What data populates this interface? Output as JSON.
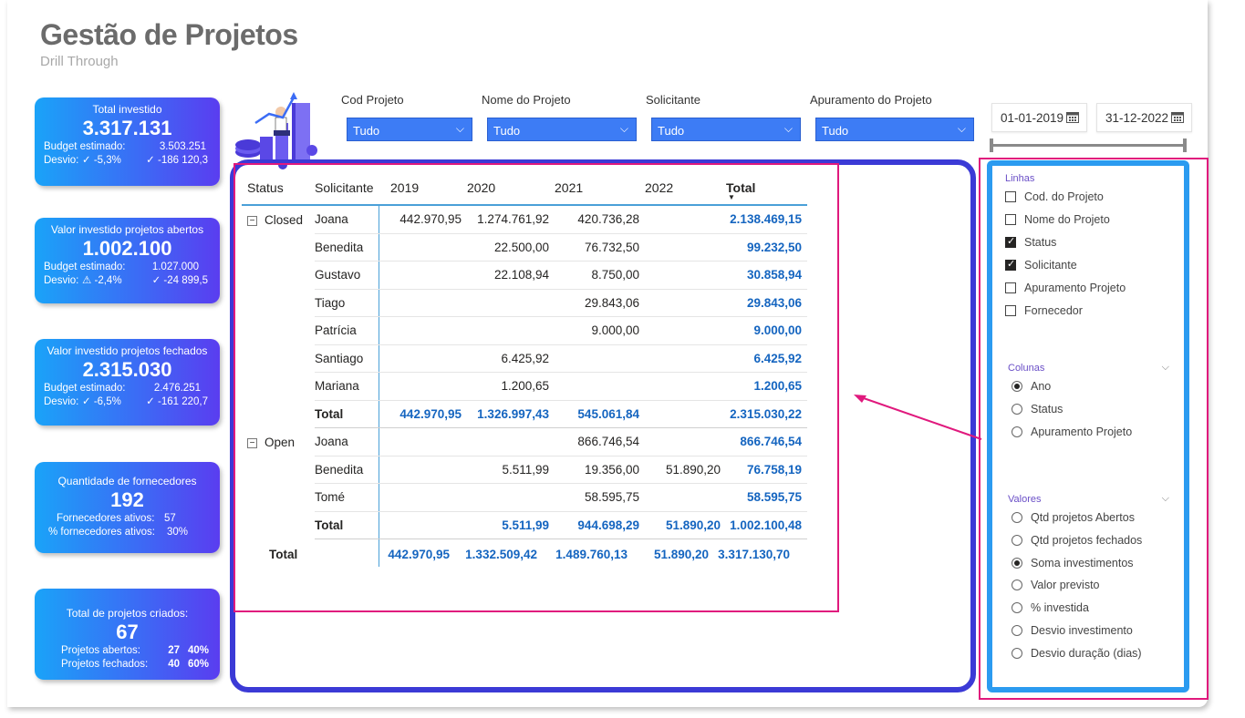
{
  "header": {
    "title": "Gestão de Projetos",
    "subtitle": "Drill Through"
  },
  "kpis": {
    "total_investido": {
      "label": "Total investido",
      "value": "3.317.131",
      "budget_label": "Budget estimado:",
      "budget_value": "3.503.251",
      "desvio_label": "Desvio:",
      "desvio_pct": "✓ -5,3%",
      "desvio_abs": "✓ -186 120,3"
    },
    "abertos": {
      "label": "Valor investido projetos abertos",
      "value": "1.002.100",
      "budget_label": "Budget estimado:",
      "budget_value": "1.027.000",
      "desvio_label": "Desvio:",
      "desvio_pct": "⚠ -2,4%",
      "desvio_abs": "✓ -24 899,5"
    },
    "fechados": {
      "label": "Valor investido projetos fechados",
      "value": "2.315.030",
      "budget_label": "Budget estimado:",
      "budget_value": "2.476.251",
      "desvio_label": "Desvio:",
      "desvio_pct": "✓ -6,5%",
      "desvio_abs": "✓ -161 220,7"
    },
    "fornecedores": {
      "label": "Quantidade de fornecedores",
      "value": "192",
      "ativos_label": "Fornecedores ativos:",
      "ativos_value": "57",
      "pct_label": "% fornecedores ativos:",
      "pct_value": "30%"
    },
    "projetos": {
      "label": "Total de projetos criados:",
      "value": "67",
      "abertos_label": "Projetos abertos:",
      "abertos_value": "27",
      "abertos_pct": "40%",
      "fechados_label": "Projetos fechados:",
      "fechados_value": "40",
      "fechados_pct": "60%"
    }
  },
  "slicers": [
    {
      "label": "Cod Projeto",
      "value": "Tudo"
    },
    {
      "label": "Nome do Projeto",
      "value": "Tudo"
    },
    {
      "label": "Solicitante",
      "value": "Tudo"
    },
    {
      "label": "Apuramento do Projeto",
      "value": "Tudo"
    }
  ],
  "dates": {
    "start": "01-01-2019",
    "end": "31-12-2022"
  },
  "matrix": {
    "headers": {
      "status": "Status",
      "solicitante": "Solicitante",
      "y2019": "2019",
      "y2020": "2020",
      "y2021": "2021",
      "y2022": "2022",
      "total": "Total"
    },
    "closed": {
      "label": "Closed",
      "rows": [
        {
          "name": "Joana",
          "v2019": "442.970,95",
          "v2020": "1.274.761,92",
          "v2021": "420.736,28",
          "v2022": "",
          "total": "2.138.469,15"
        },
        {
          "name": "Benedita",
          "v2019": "",
          "v2020": "22.500,00",
          "v2021": "76.732,50",
          "v2022": "",
          "total": "99.232,50"
        },
        {
          "name": "Gustavo",
          "v2019": "",
          "v2020": "22.108,94",
          "v2021": "8.750,00",
          "v2022": "",
          "total": "30.858,94"
        },
        {
          "name": "Tiago",
          "v2019": "",
          "v2020": "",
          "v2021": "29.843,06",
          "v2022": "",
          "total": "29.843,06"
        },
        {
          "name": "Patrícia",
          "v2019": "",
          "v2020": "",
          "v2021": "9.000,00",
          "v2022": "",
          "total": "9.000,00"
        },
        {
          "name": "Santiago",
          "v2019": "",
          "v2020": "6.425,92",
          "v2021": "",
          "v2022": "",
          "total": "6.425,92"
        },
        {
          "name": "Mariana",
          "v2019": "",
          "v2020": "1.200,65",
          "v2021": "",
          "v2022": "",
          "total": "1.200,65"
        }
      ],
      "subtotal": {
        "name": "Total",
        "v2019": "442.970,95",
        "v2020": "1.326.997,43",
        "v2021": "545.061,84",
        "v2022": "",
        "total": "2.315.030,22"
      }
    },
    "open": {
      "label": "Open",
      "rows": [
        {
          "name": "Joana",
          "v2019": "",
          "v2020": "",
          "v2021": "866.746,54",
          "v2022": "",
          "total": "866.746,54"
        },
        {
          "name": "Benedita",
          "v2019": "",
          "v2020": "5.511,99",
          "v2021": "19.356,00",
          "v2022": "51.890,20",
          "total": "76.758,19"
        },
        {
          "name": "Tomé",
          "v2019": "",
          "v2020": "",
          "v2021": "58.595,75",
          "v2022": "",
          "total": "58.595,75"
        }
      ],
      "subtotal": {
        "name": "Total",
        "v2019": "",
        "v2020": "5.511,99",
        "v2021": "944.698,29",
        "v2022": "51.890,20",
        "total": "1.002.100,48"
      }
    },
    "grand_total": {
      "label": "Total",
      "v2019": "442.970,95",
      "v2020": "1.332.509,42",
      "v2021": "1.489.760,13",
      "v2022": "51.890,20",
      "total": "3.317.130,70"
    }
  },
  "panel": {
    "linhas": {
      "title": "Linhas",
      "items": [
        {
          "label": "Cod. do Projeto",
          "checked": false
        },
        {
          "label": "Nome do Projeto",
          "checked": false
        },
        {
          "label": "Status",
          "checked": true
        },
        {
          "label": "Solicitante",
          "checked": true
        },
        {
          "label": "Apuramento Projeto",
          "checked": false
        },
        {
          "label": "Fornecedor",
          "checked": false
        }
      ]
    },
    "colunas": {
      "title": "Colunas",
      "items": [
        {
          "label": "Ano",
          "selected": true
        },
        {
          "label": "Status",
          "selected": false
        },
        {
          "label": "Apuramento Projeto",
          "selected": false
        }
      ]
    },
    "valores": {
      "title": "Valores",
      "items": [
        {
          "label": "Qtd projetos Abertos",
          "selected": false
        },
        {
          "label": "Qtd projetos fechados",
          "selected": false
        },
        {
          "label": "Soma investimentos",
          "selected": true
        },
        {
          "label": "Valor previsto",
          "selected": false
        },
        {
          "label": "% investida",
          "selected": false
        },
        {
          "label": "Desvio investimento",
          "selected": false
        },
        {
          "label": "Desvio duração (dias)",
          "selected": false
        }
      ]
    }
  },
  "colors": {
    "accent_blue": "#3d7cf5",
    "frame_purple": "#3b3ad6",
    "highlight_pink": "#e0197d",
    "total_blue": "#1565c0"
  }
}
